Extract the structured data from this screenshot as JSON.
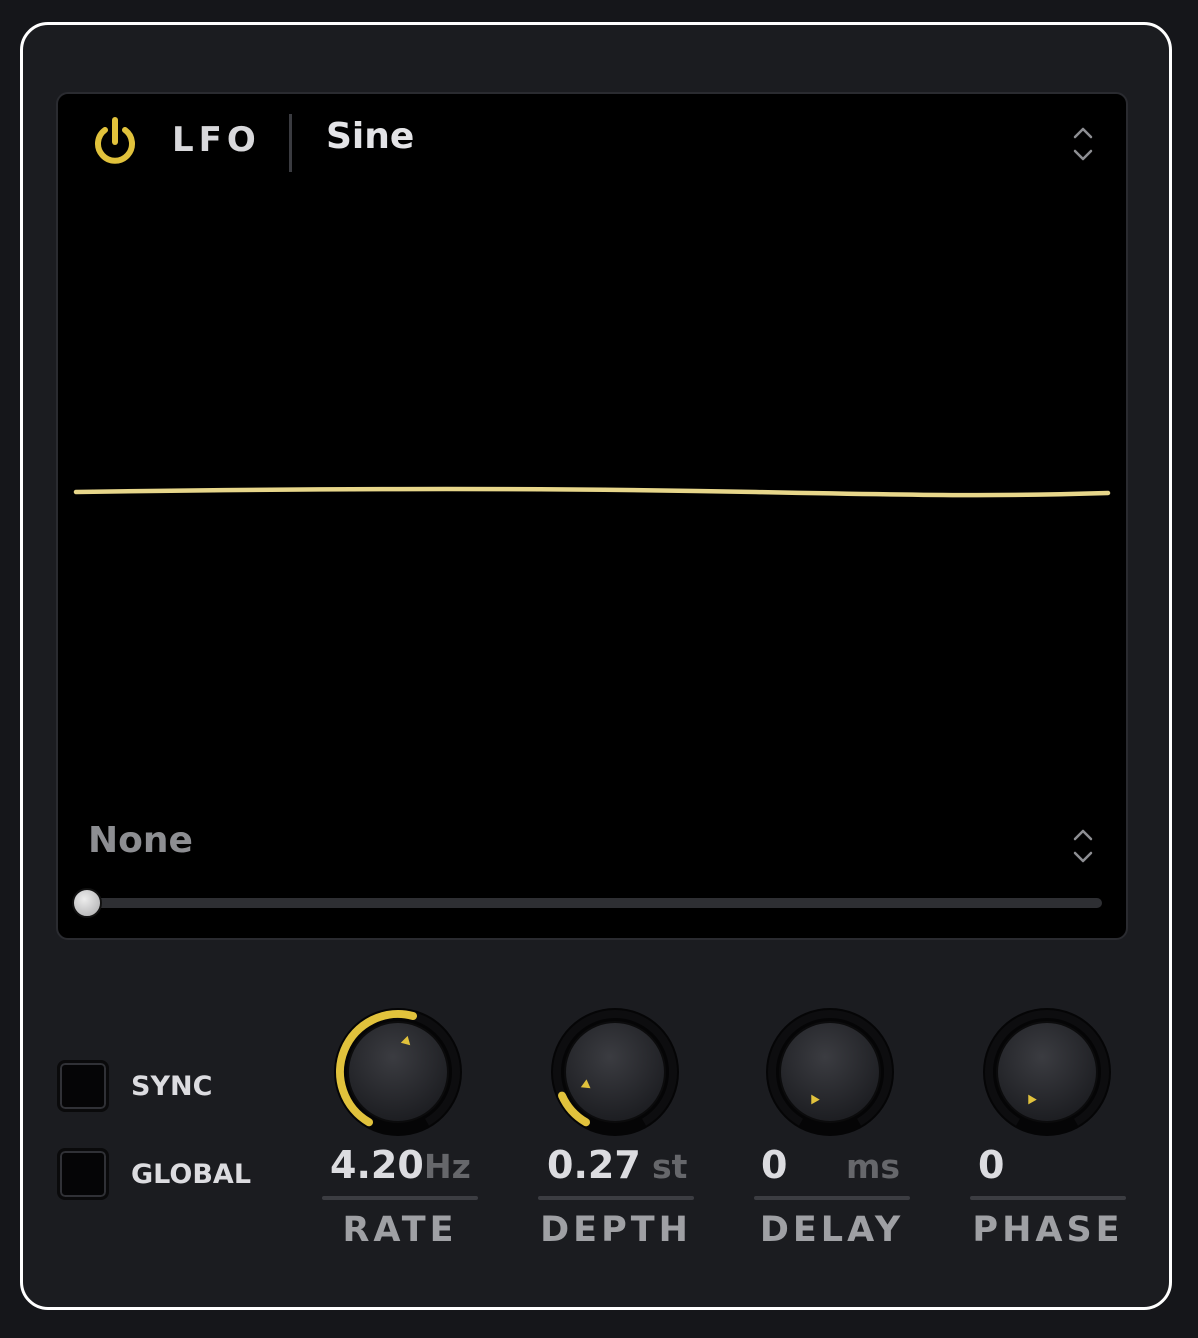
{
  "lfo": {
    "title": "LFO",
    "power_on": true,
    "waveform": "Sine",
    "accent_color": "#e1c23c",
    "wave_color": "#e7d68a"
  },
  "modulation": {
    "source": "None",
    "amount": 0.0
  },
  "toggles": [
    {
      "label": "SYNC",
      "checked": false
    },
    {
      "label": "GLOBAL",
      "checked": false
    }
  ],
  "knobs": [
    {
      "name": "RATE",
      "value": "4.20",
      "unit": "Hz",
      "level": 0.55
    },
    {
      "name": "DEPTH",
      "value": "0.27",
      "unit": "st",
      "level": 0.12
    },
    {
      "name": "DELAY",
      "value": "0",
      "unit": "ms",
      "level": 0.0
    },
    {
      "name": "PHASE",
      "value": "0",
      "unit": "",
      "level": 0.0
    }
  ]
}
